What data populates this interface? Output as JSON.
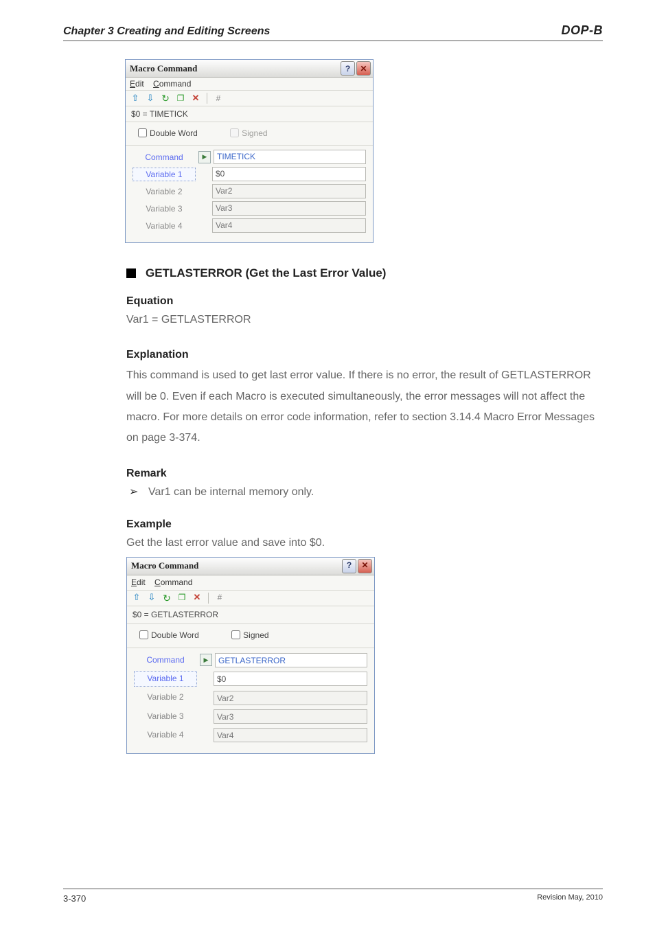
{
  "header": {
    "chapter": "Chapter 3 Creating and Editing Screens",
    "brand": "DOP-B"
  },
  "dialog1": {
    "title": "Macro Command",
    "menu_edit": "Edit",
    "menu_command": "Command",
    "hash": "#",
    "equation": "$0 = TIMETICK",
    "dword": "Double Word",
    "signed": "Signed",
    "lbl_command": "Command",
    "val_command": "TIMETICK",
    "lbl_v1": "Variable 1",
    "val_v1": "$0",
    "lbl_v2": "Variable 2",
    "val_v2": "Var2",
    "lbl_v3": "Variable 3",
    "val_v3": "Var3",
    "lbl_v4": "Variable 4",
    "val_v4": "Var4"
  },
  "section": {
    "title": "GETLASTERROR (Get the Last Error Value)",
    "eq_label": "Equation",
    "eq_text": "Var1 = GETLASTERROR",
    "expl_label": "Explanation",
    "expl_text": "This command is used to get last error value. If there is no error, the result of GETLASTERROR will be 0. Even if each Macro is executed simultaneously, the error messages will not affect the macro. For more details on error code information, refer to section 3.14.4 Macro Error Messages on page 3-374.",
    "remark_label": "Remark",
    "remark_bullet": "Var1 can be internal memory only.",
    "example_label": "Example",
    "example_text": "Get the last error value and save into $0."
  },
  "dialog2": {
    "title": "Macro Command",
    "menu_edit": "Edit",
    "menu_command": "Command",
    "hash": "#",
    "equation": "$0 = GETLASTERROR",
    "dword": "Double Word",
    "signed": "Signed",
    "lbl_command": "Command",
    "val_command": "GETLASTERROR",
    "lbl_v1": "Variable 1",
    "val_v1": "$0",
    "lbl_v2": "Variable 2",
    "val_v2": "Var2",
    "lbl_v3": "Variable 3",
    "val_v3": "Var3",
    "lbl_v4": "Variable 4",
    "val_v4": "Var4"
  },
  "footer": {
    "page": "3-370",
    "rev": "Revision May, 2010"
  }
}
